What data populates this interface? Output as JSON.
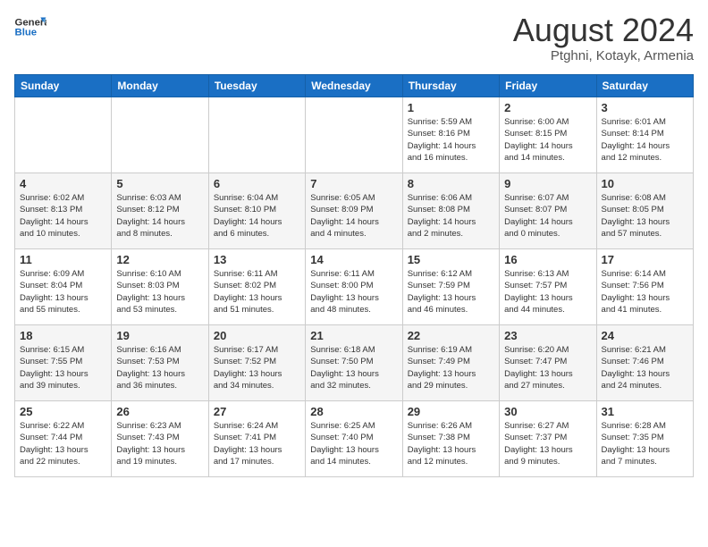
{
  "header": {
    "logo_general": "General",
    "logo_blue": "Blue",
    "month_year": "August 2024",
    "location": "Ptghni, Kotayk, Armenia"
  },
  "days_of_week": [
    "Sunday",
    "Monday",
    "Tuesday",
    "Wednesday",
    "Thursday",
    "Friday",
    "Saturday"
  ],
  "weeks": [
    [
      {
        "day": "",
        "info": ""
      },
      {
        "day": "",
        "info": ""
      },
      {
        "day": "",
        "info": ""
      },
      {
        "day": "",
        "info": ""
      },
      {
        "day": "1",
        "info": "Sunrise: 5:59 AM\nSunset: 8:16 PM\nDaylight: 14 hours\nand 16 minutes."
      },
      {
        "day": "2",
        "info": "Sunrise: 6:00 AM\nSunset: 8:15 PM\nDaylight: 14 hours\nand 14 minutes."
      },
      {
        "day": "3",
        "info": "Sunrise: 6:01 AM\nSunset: 8:14 PM\nDaylight: 14 hours\nand 12 minutes."
      }
    ],
    [
      {
        "day": "4",
        "info": "Sunrise: 6:02 AM\nSunset: 8:13 PM\nDaylight: 14 hours\nand 10 minutes."
      },
      {
        "day": "5",
        "info": "Sunrise: 6:03 AM\nSunset: 8:12 PM\nDaylight: 14 hours\nand 8 minutes."
      },
      {
        "day": "6",
        "info": "Sunrise: 6:04 AM\nSunset: 8:10 PM\nDaylight: 14 hours\nand 6 minutes."
      },
      {
        "day": "7",
        "info": "Sunrise: 6:05 AM\nSunset: 8:09 PM\nDaylight: 14 hours\nand 4 minutes."
      },
      {
        "day": "8",
        "info": "Sunrise: 6:06 AM\nSunset: 8:08 PM\nDaylight: 14 hours\nand 2 minutes."
      },
      {
        "day": "9",
        "info": "Sunrise: 6:07 AM\nSunset: 8:07 PM\nDaylight: 14 hours\nand 0 minutes."
      },
      {
        "day": "10",
        "info": "Sunrise: 6:08 AM\nSunset: 8:05 PM\nDaylight: 13 hours\nand 57 minutes."
      }
    ],
    [
      {
        "day": "11",
        "info": "Sunrise: 6:09 AM\nSunset: 8:04 PM\nDaylight: 13 hours\nand 55 minutes."
      },
      {
        "day": "12",
        "info": "Sunrise: 6:10 AM\nSunset: 8:03 PM\nDaylight: 13 hours\nand 53 minutes."
      },
      {
        "day": "13",
        "info": "Sunrise: 6:11 AM\nSunset: 8:02 PM\nDaylight: 13 hours\nand 51 minutes."
      },
      {
        "day": "14",
        "info": "Sunrise: 6:11 AM\nSunset: 8:00 PM\nDaylight: 13 hours\nand 48 minutes."
      },
      {
        "day": "15",
        "info": "Sunrise: 6:12 AM\nSunset: 7:59 PM\nDaylight: 13 hours\nand 46 minutes."
      },
      {
        "day": "16",
        "info": "Sunrise: 6:13 AM\nSunset: 7:57 PM\nDaylight: 13 hours\nand 44 minutes."
      },
      {
        "day": "17",
        "info": "Sunrise: 6:14 AM\nSunset: 7:56 PM\nDaylight: 13 hours\nand 41 minutes."
      }
    ],
    [
      {
        "day": "18",
        "info": "Sunrise: 6:15 AM\nSunset: 7:55 PM\nDaylight: 13 hours\nand 39 minutes."
      },
      {
        "day": "19",
        "info": "Sunrise: 6:16 AM\nSunset: 7:53 PM\nDaylight: 13 hours\nand 36 minutes."
      },
      {
        "day": "20",
        "info": "Sunrise: 6:17 AM\nSunset: 7:52 PM\nDaylight: 13 hours\nand 34 minutes."
      },
      {
        "day": "21",
        "info": "Sunrise: 6:18 AM\nSunset: 7:50 PM\nDaylight: 13 hours\nand 32 minutes."
      },
      {
        "day": "22",
        "info": "Sunrise: 6:19 AM\nSunset: 7:49 PM\nDaylight: 13 hours\nand 29 minutes."
      },
      {
        "day": "23",
        "info": "Sunrise: 6:20 AM\nSunset: 7:47 PM\nDaylight: 13 hours\nand 27 minutes."
      },
      {
        "day": "24",
        "info": "Sunrise: 6:21 AM\nSunset: 7:46 PM\nDaylight: 13 hours\nand 24 minutes."
      }
    ],
    [
      {
        "day": "25",
        "info": "Sunrise: 6:22 AM\nSunset: 7:44 PM\nDaylight: 13 hours\nand 22 minutes."
      },
      {
        "day": "26",
        "info": "Sunrise: 6:23 AM\nSunset: 7:43 PM\nDaylight: 13 hours\nand 19 minutes."
      },
      {
        "day": "27",
        "info": "Sunrise: 6:24 AM\nSunset: 7:41 PM\nDaylight: 13 hours\nand 17 minutes."
      },
      {
        "day": "28",
        "info": "Sunrise: 6:25 AM\nSunset: 7:40 PM\nDaylight: 13 hours\nand 14 minutes."
      },
      {
        "day": "29",
        "info": "Sunrise: 6:26 AM\nSunset: 7:38 PM\nDaylight: 13 hours\nand 12 minutes."
      },
      {
        "day": "30",
        "info": "Sunrise: 6:27 AM\nSunset: 7:37 PM\nDaylight: 13 hours\nand 9 minutes."
      },
      {
        "day": "31",
        "info": "Sunrise: 6:28 AM\nSunset: 7:35 PM\nDaylight: 13 hours\nand 7 minutes."
      }
    ]
  ]
}
